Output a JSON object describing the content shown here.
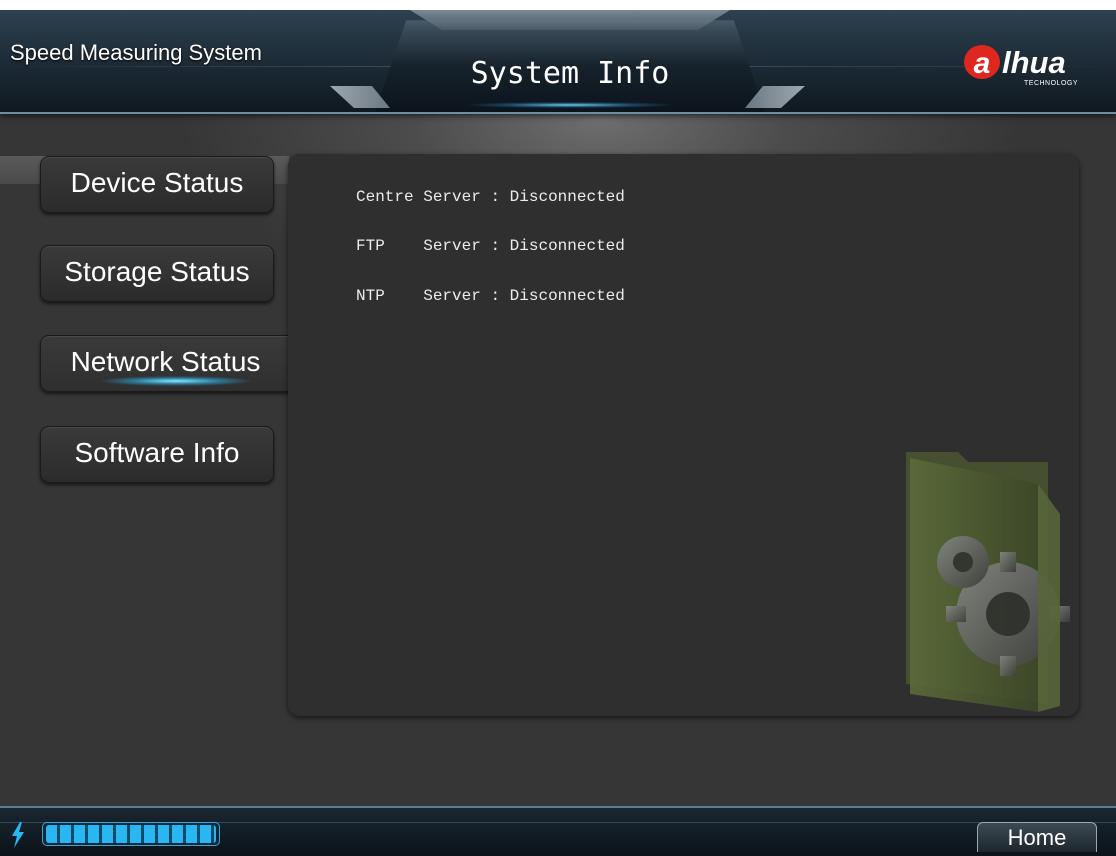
{
  "header": {
    "app_title": "Speed Measuring System",
    "page_title": "System Info",
    "logo": {
      "text": "alhua",
      "sub": "TECHNOLOGY",
      "accent_color": "#e0271f"
    }
  },
  "sidebar": {
    "items": [
      {
        "label": "Device Status",
        "active": false
      },
      {
        "label": "Storage Status",
        "active": false
      },
      {
        "label": "Network Status",
        "active": true
      },
      {
        "label": "Software Info",
        "active": false
      }
    ]
  },
  "network_status": {
    "rows": [
      {
        "name": "Centre Server",
        "separator": ":",
        "status": "Disconnected"
      },
      {
        "name": "FTP    Server",
        "separator": ":",
        "status": "Disconnected"
      },
      {
        "name": "NTP    Server",
        "separator": ":",
        "status": "Disconnected"
      }
    ]
  },
  "footer": {
    "home_label": "Home",
    "progress_fraction": 1.0,
    "power_icon": "lightning-icon",
    "accent_color": "#2ab6f0"
  }
}
